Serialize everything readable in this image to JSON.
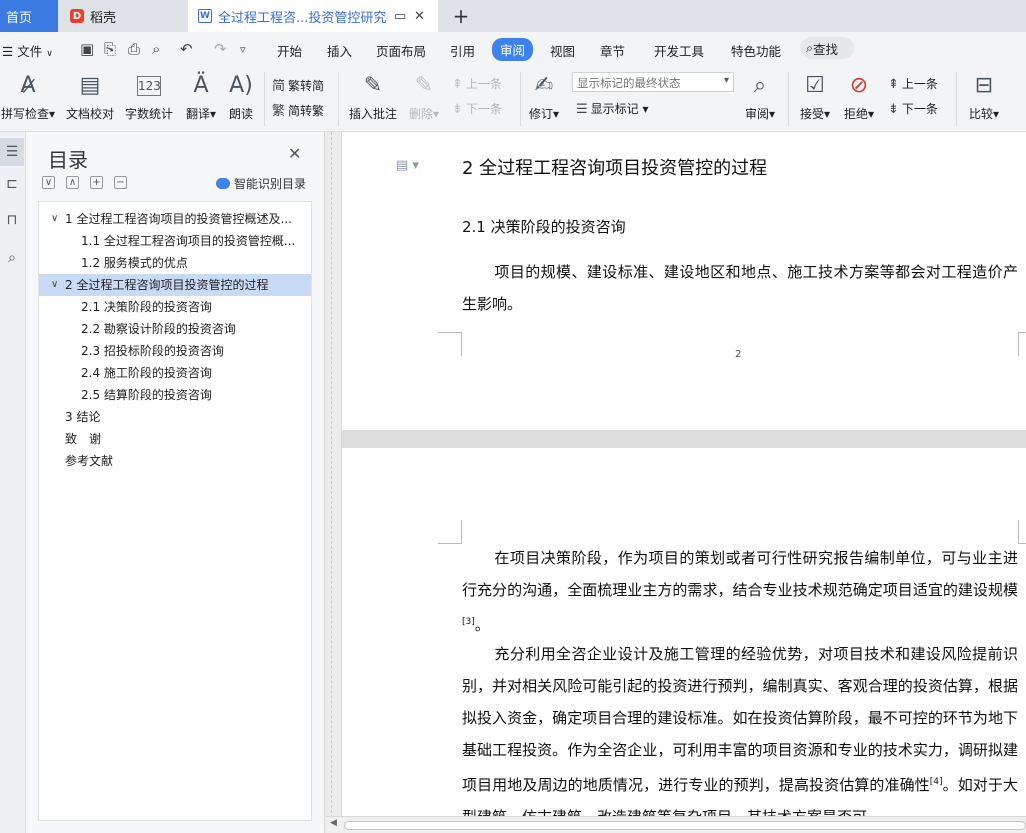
{
  "tabs": {
    "home": "首页",
    "daoke": "稻壳",
    "document": "全过程工程咨...投资管控研究"
  },
  "menu": {
    "file": "文件",
    "items": [
      "开始",
      "插入",
      "页面布局",
      "引用",
      "审阅",
      "视图",
      "章节",
      "开发工具",
      "特色功能"
    ],
    "active": "审阅",
    "search": "查找"
  },
  "ribbon": {
    "spell_check": "拼写检查",
    "doc_check": "文档校对",
    "word_count": "字数统计",
    "translate": "翻译",
    "read_aloud": "朗读",
    "to_traditional": "繁转简",
    "to_simplified": "简转繁",
    "insert_comment": "插入批注",
    "delete": "删除",
    "prev_comment": "上一条",
    "next_comment": "下一条",
    "track_changes": "修订",
    "markup_state": "显示标记的最终状态",
    "show_markup": "显示标记",
    "review": "审阅",
    "accept": "接受",
    "reject": "拒绝",
    "prev_change": "上一条",
    "next_change": "下一条",
    "compare": "比较"
  },
  "toc": {
    "title": "目录",
    "smart": "智能识别目录",
    "items": [
      {
        "text": "1 全过程工程咨询项目的投资管控概述及...",
        "level": 1,
        "expanded": true
      },
      {
        "text": "1.1 全过程工程咨询项目的投资管控概...",
        "level": 2
      },
      {
        "text": "1.2 服务模式的优点",
        "level": 2
      },
      {
        "text": "2 全过程工程咨询项目投资管控的过程",
        "level": 1,
        "expanded": true,
        "selected": true
      },
      {
        "text": "2.1 决策阶段的投资咨询",
        "level": 2
      },
      {
        "text": "2.2 勘察设计阶段的投资咨询",
        "level": 2
      },
      {
        "text": "2.3 招投标阶段的投资咨询",
        "level": 2
      },
      {
        "text": "2.4 施工阶段的投资咨询",
        "level": 2
      },
      {
        "text": "2.5 结算阶段的投资咨询",
        "level": 2
      },
      {
        "text": "3 结论",
        "level": 1
      },
      {
        "text": "致　谢",
        "level": 1
      },
      {
        "text": "参考文献",
        "level": 1
      }
    ]
  },
  "doc": {
    "heading2": "2 全过程工程咨询项目投资管控的过程",
    "heading3": "2.1 决策阶段的投资咨询",
    "para1": "项目的规模、建设标准、建设地区和地点、施工技术方案等都会对工程造价产生影响。",
    "page_number": "2",
    "para2_a": "在项目决策阶段，作为项目的策划或者可行性研究报告编制单位，可与业主进行充分的沟通，全面梳理业主方的需求，结合专业技术规范确定项目适宜的建设规模",
    "para2_ref": "[3]",
    "para2_b": "。",
    "para3_a": "充分利用全咨企业设计及施工管理的经验优势，对项目技术和建设风险提前识别，并对相关风险可能引起的投资进行预判，编制真实、客观合理的投资估算，根据拟投入资金，确定项目合理的建设标准。如在投资估算阶段，最不可控的环节为地下基础工程投资。作为全咨企业，可利用丰富的项目资源和专业的技术实力，调研拟建项目用地及周边的地质情况，进行专业的预判，提高投资估算的准确性",
    "para3_ref": "[4]",
    "para3_b": "。如对于大型建筑、仿古建筑、改造建筑等复杂项目，其技术方案是否可"
  }
}
